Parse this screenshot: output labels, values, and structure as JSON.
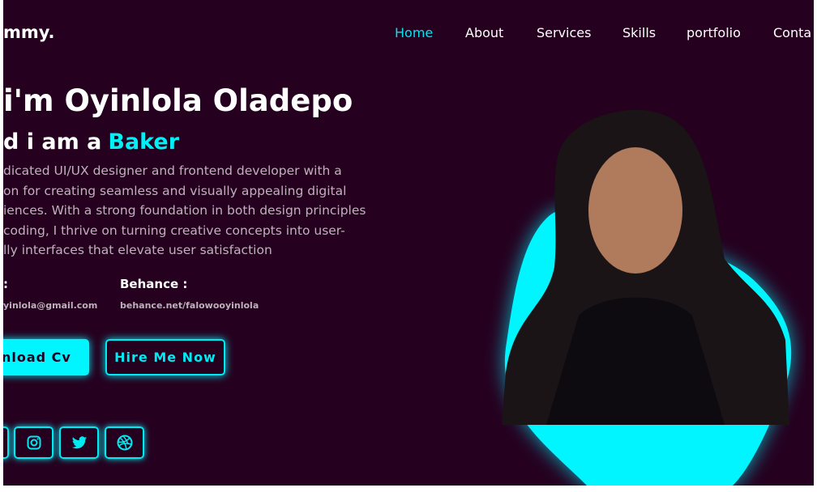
{
  "logo": "mmy.",
  "nav": [
    "Home",
    "About",
    "Services",
    "Skills",
    "portfolio",
    "Conta"
  ],
  "hero": {
    "heading": "i'm Oyinlola Oladepo",
    "subheading_prefix": "d i am a",
    "role": "Baker",
    "description": [
      "dicated UI/UX designer and frontend developer with a",
      "on for creating seamless and visually appealing digital",
      "iences. With a strong foundation in both design principles",
      "coding, I thrive on turning creative concepts into user-",
      "lly interfaces that elevate user satisfaction"
    ]
  },
  "contact": {
    "email_label": ":",
    "email": "yinlola@gmail.com",
    "behance_label": "Behance :",
    "behance": "behance.net/falowooyinlola"
  },
  "buttons": {
    "download": "wnload Cv",
    "hire": "Hire Me Now"
  },
  "social_icons": [
    "linkedin-icon",
    "instagram-icon",
    "twitter-icon",
    "dribbble-icon"
  ],
  "colors": {
    "background": "#25001f",
    "accent": "#00f0f5"
  }
}
